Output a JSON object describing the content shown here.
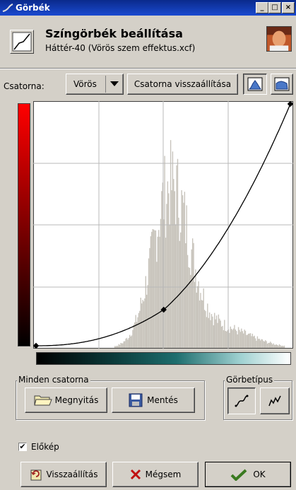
{
  "window": {
    "title": "Görbék"
  },
  "header": {
    "title": "Színgörbék beállítása",
    "subtitle": "Háttér-40 (Vörös szem effektus.xcf)"
  },
  "channel": {
    "label": "Csatorna:",
    "selected": "Vörös",
    "reset_label": "Csatorna visszaállítása"
  },
  "groups": {
    "all_channels": "Minden csatorna",
    "open_label": "Megnyitás",
    "save_label": "Mentés",
    "curve_type": "Görbetípus"
  },
  "preview": {
    "label": "Előkép",
    "checked": true
  },
  "footer": {
    "reset_label": "Visszaállítás",
    "cancel_label": "Mégsem",
    "ok_label": "OK"
  },
  "curve": {
    "points": [
      [
        0,
        0
      ],
      [
        128,
        38
      ],
      [
        255,
        255
      ]
    ]
  },
  "colors": {
    "title_bar": "#0a2a8c",
    "red_gradient_top": "#ff0000"
  }
}
